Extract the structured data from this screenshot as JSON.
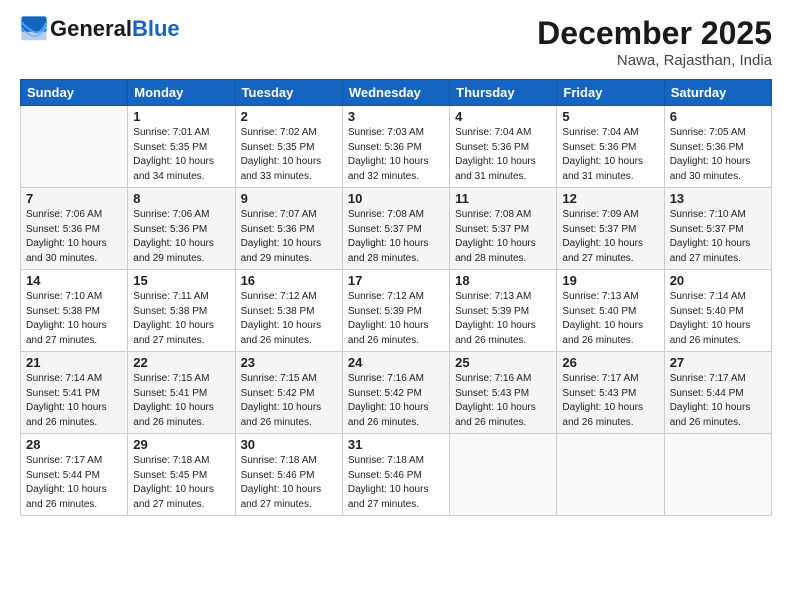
{
  "header": {
    "logo_general": "General",
    "logo_blue": "Blue",
    "month_title": "December 2025",
    "location": "Nawa, Rajasthan, India"
  },
  "columns": [
    "Sunday",
    "Monday",
    "Tuesday",
    "Wednesday",
    "Thursday",
    "Friday",
    "Saturday"
  ],
  "weeks": [
    [
      {
        "day": "",
        "info": ""
      },
      {
        "day": "1",
        "info": "Sunrise: 7:01 AM\nSunset: 5:35 PM\nDaylight: 10 hours\nand 34 minutes."
      },
      {
        "day": "2",
        "info": "Sunrise: 7:02 AM\nSunset: 5:35 PM\nDaylight: 10 hours\nand 33 minutes."
      },
      {
        "day": "3",
        "info": "Sunrise: 7:03 AM\nSunset: 5:36 PM\nDaylight: 10 hours\nand 32 minutes."
      },
      {
        "day": "4",
        "info": "Sunrise: 7:04 AM\nSunset: 5:36 PM\nDaylight: 10 hours\nand 31 minutes."
      },
      {
        "day": "5",
        "info": "Sunrise: 7:04 AM\nSunset: 5:36 PM\nDaylight: 10 hours\nand 31 minutes."
      },
      {
        "day": "6",
        "info": "Sunrise: 7:05 AM\nSunset: 5:36 PM\nDaylight: 10 hours\nand 30 minutes."
      }
    ],
    [
      {
        "day": "7",
        "info": "Sunrise: 7:06 AM\nSunset: 5:36 PM\nDaylight: 10 hours\nand 30 minutes."
      },
      {
        "day": "8",
        "info": "Sunrise: 7:06 AM\nSunset: 5:36 PM\nDaylight: 10 hours\nand 29 minutes."
      },
      {
        "day": "9",
        "info": "Sunrise: 7:07 AM\nSunset: 5:36 PM\nDaylight: 10 hours\nand 29 minutes."
      },
      {
        "day": "10",
        "info": "Sunrise: 7:08 AM\nSunset: 5:37 PM\nDaylight: 10 hours\nand 28 minutes."
      },
      {
        "day": "11",
        "info": "Sunrise: 7:08 AM\nSunset: 5:37 PM\nDaylight: 10 hours\nand 28 minutes."
      },
      {
        "day": "12",
        "info": "Sunrise: 7:09 AM\nSunset: 5:37 PM\nDaylight: 10 hours\nand 27 minutes."
      },
      {
        "day": "13",
        "info": "Sunrise: 7:10 AM\nSunset: 5:37 PM\nDaylight: 10 hours\nand 27 minutes."
      }
    ],
    [
      {
        "day": "14",
        "info": "Sunrise: 7:10 AM\nSunset: 5:38 PM\nDaylight: 10 hours\nand 27 minutes."
      },
      {
        "day": "15",
        "info": "Sunrise: 7:11 AM\nSunset: 5:38 PM\nDaylight: 10 hours\nand 27 minutes."
      },
      {
        "day": "16",
        "info": "Sunrise: 7:12 AM\nSunset: 5:38 PM\nDaylight: 10 hours\nand 26 minutes."
      },
      {
        "day": "17",
        "info": "Sunrise: 7:12 AM\nSunset: 5:39 PM\nDaylight: 10 hours\nand 26 minutes."
      },
      {
        "day": "18",
        "info": "Sunrise: 7:13 AM\nSunset: 5:39 PM\nDaylight: 10 hours\nand 26 minutes."
      },
      {
        "day": "19",
        "info": "Sunrise: 7:13 AM\nSunset: 5:40 PM\nDaylight: 10 hours\nand 26 minutes."
      },
      {
        "day": "20",
        "info": "Sunrise: 7:14 AM\nSunset: 5:40 PM\nDaylight: 10 hours\nand 26 minutes."
      }
    ],
    [
      {
        "day": "21",
        "info": "Sunrise: 7:14 AM\nSunset: 5:41 PM\nDaylight: 10 hours\nand 26 minutes."
      },
      {
        "day": "22",
        "info": "Sunrise: 7:15 AM\nSunset: 5:41 PM\nDaylight: 10 hours\nand 26 minutes."
      },
      {
        "day": "23",
        "info": "Sunrise: 7:15 AM\nSunset: 5:42 PM\nDaylight: 10 hours\nand 26 minutes."
      },
      {
        "day": "24",
        "info": "Sunrise: 7:16 AM\nSunset: 5:42 PM\nDaylight: 10 hours\nand 26 minutes."
      },
      {
        "day": "25",
        "info": "Sunrise: 7:16 AM\nSunset: 5:43 PM\nDaylight: 10 hours\nand 26 minutes."
      },
      {
        "day": "26",
        "info": "Sunrise: 7:17 AM\nSunset: 5:43 PM\nDaylight: 10 hours\nand 26 minutes."
      },
      {
        "day": "27",
        "info": "Sunrise: 7:17 AM\nSunset: 5:44 PM\nDaylight: 10 hours\nand 26 minutes."
      }
    ],
    [
      {
        "day": "28",
        "info": "Sunrise: 7:17 AM\nSunset: 5:44 PM\nDaylight: 10 hours\nand 26 minutes."
      },
      {
        "day": "29",
        "info": "Sunrise: 7:18 AM\nSunset: 5:45 PM\nDaylight: 10 hours\nand 27 minutes."
      },
      {
        "day": "30",
        "info": "Sunrise: 7:18 AM\nSunset: 5:46 PM\nDaylight: 10 hours\nand 27 minutes."
      },
      {
        "day": "31",
        "info": "Sunrise: 7:18 AM\nSunset: 5:46 PM\nDaylight: 10 hours\nand 27 minutes."
      },
      {
        "day": "",
        "info": ""
      },
      {
        "day": "",
        "info": ""
      },
      {
        "day": "",
        "info": ""
      }
    ]
  ]
}
